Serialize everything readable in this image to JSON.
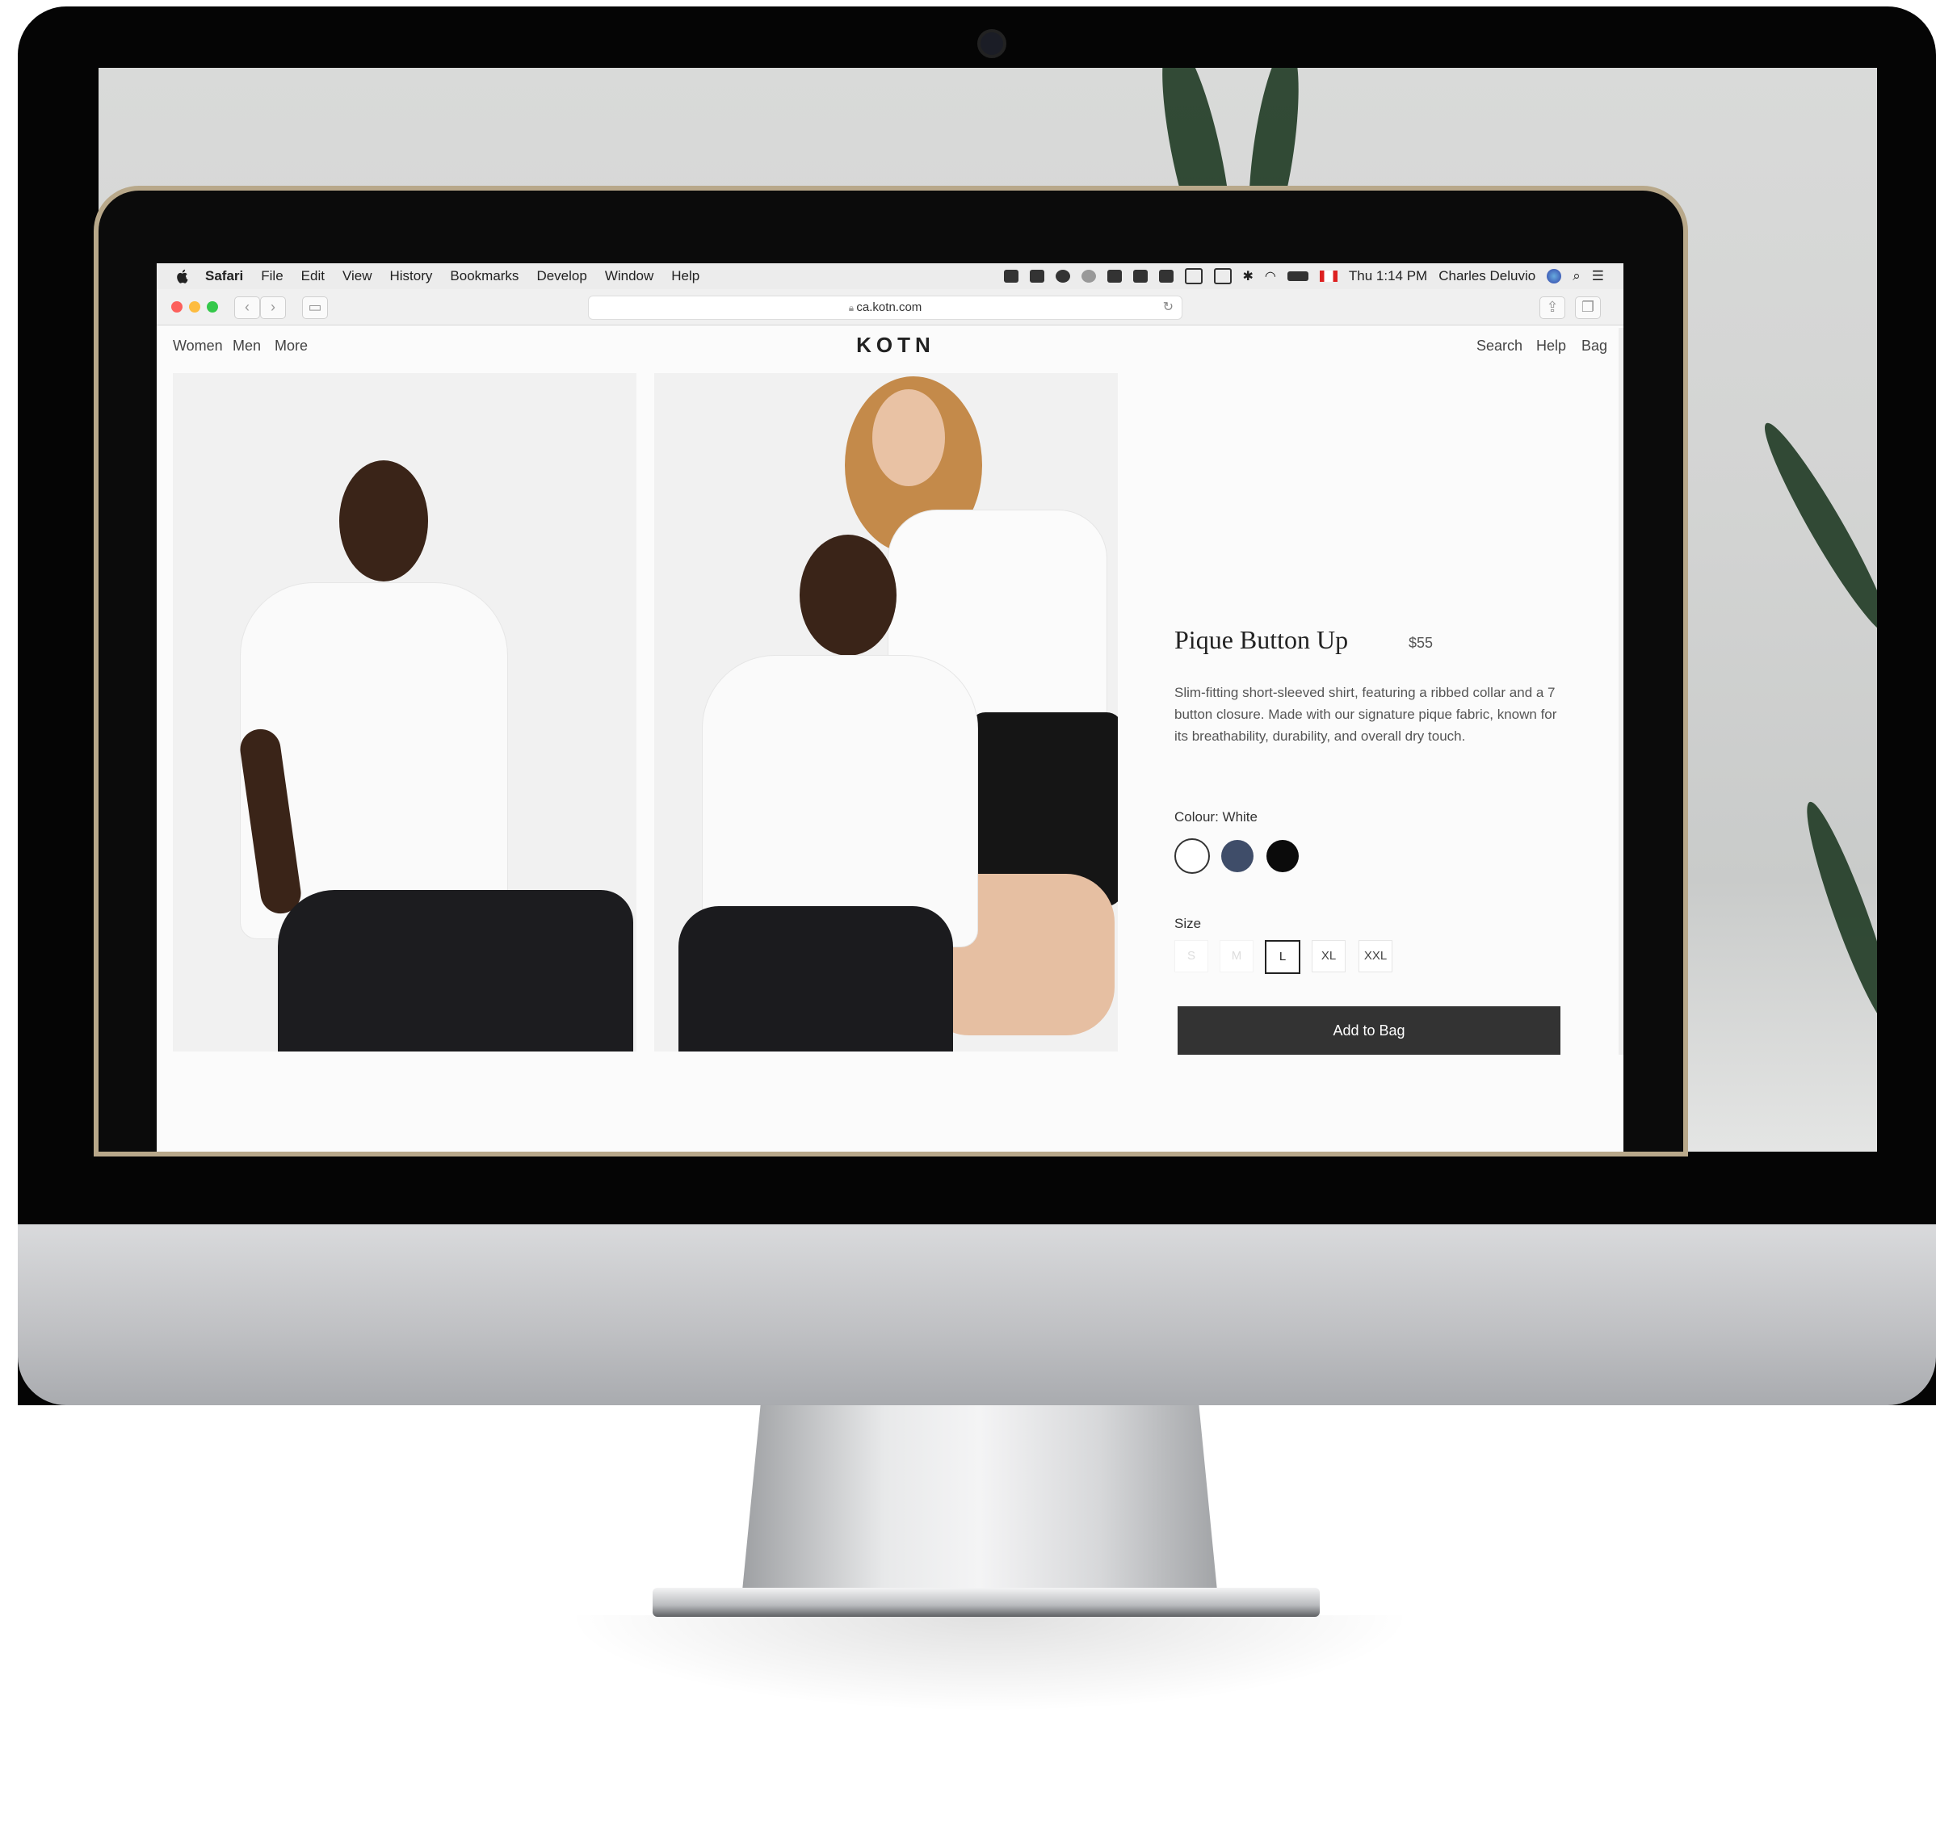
{
  "menubar": {
    "app_name": "Safari",
    "menus": [
      "File",
      "Edit",
      "View",
      "History",
      "Bookmarks",
      "Develop",
      "Window",
      "Help"
    ],
    "clock": "Thu 1:14 PM",
    "user": "Charles Deluvio"
  },
  "browser": {
    "url": "ca.kotn.com"
  },
  "site": {
    "left_nav": [
      "Women",
      "Men",
      "More"
    ],
    "logo": "KOTN",
    "right_nav": [
      "Search",
      "Help",
      "Bag"
    ]
  },
  "product": {
    "title": "Pique Button Up",
    "price": "$55",
    "description": "Slim-fitting short-sleeved shirt, featuring a ribbed collar and a 7 button closure. Made with our signature pique fabric, known for its breathability, durability, and overall dry touch.",
    "colour_label": "Colour: White",
    "colours": [
      "#ffffff",
      "#3f4d69",
      "#0b0b0b"
    ],
    "size_label": "Size",
    "sizes": [
      "S",
      "M",
      "L",
      "XL",
      "XXL"
    ],
    "selected_size": "L",
    "add_to_bag": "Add to Bag"
  }
}
